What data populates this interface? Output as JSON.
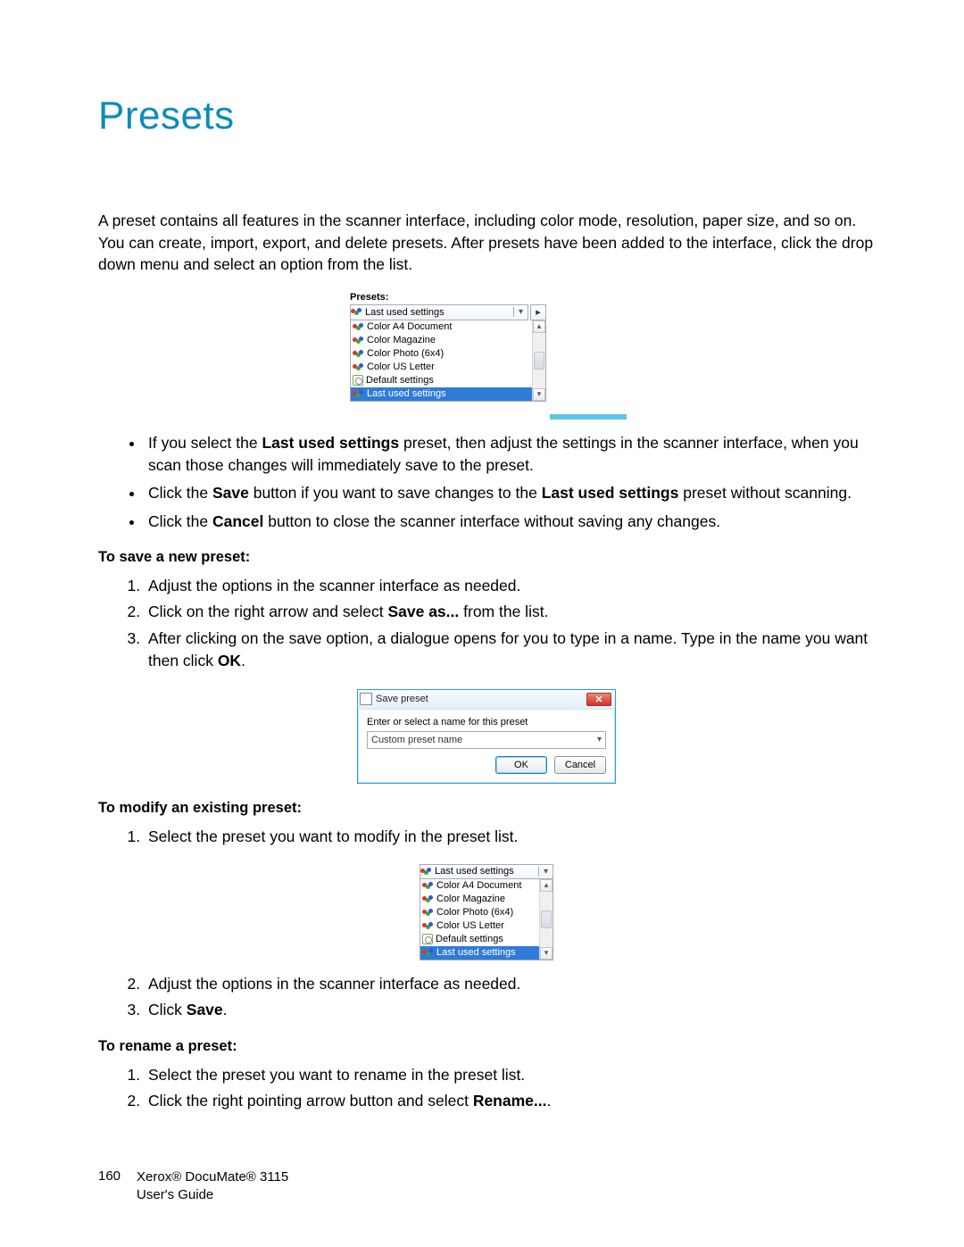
{
  "title": "Presets",
  "intro": "A preset contains all features in the scanner interface, including color mode, resolution, paper size, and so on. You can create, import, export, and delete presets. After presets have been added to the interface, click the drop down menu and select an option from the list.",
  "fig1": {
    "label": "Presets:",
    "selected": "Last used settings",
    "items": [
      "Color A4 Document",
      "Color Magazine",
      "Color Photo (6x4)",
      "Color US Letter",
      "Default settings",
      "Last used settings"
    ],
    "selected_index": 5
  },
  "bullets": [
    {
      "pre": "If you select the ",
      "b1": "Last used settings",
      "post": " preset, then adjust the settings in the scanner interface, when you scan those changes will immediately save to the preset."
    },
    {
      "pre": "Click the ",
      "b1": "Save",
      "mid": " button if you want to save changes to the ",
      "b2": "Last used settings",
      "post": " preset without scanning."
    },
    {
      "pre": "Click the ",
      "b1": "Cancel",
      "post": " button to close the scanner interface without saving any changes."
    }
  ],
  "save_head": "To save a new preset:",
  "save_steps": {
    "s1": "Adjust the options in the scanner interface as needed.",
    "s2_pre": "Click on the right arrow and select ",
    "s2_b": "Save as...",
    "s2_post": " from the list.",
    "s3_pre": "After clicking on the save option, a dialogue opens for you to type in a name. Type in the name you want then click ",
    "s3_b": "OK",
    "s3_post": "."
  },
  "dialog": {
    "title": "Save preset",
    "prompt": "Enter or select a name for this preset",
    "value": "Custom preset name",
    "ok": "OK",
    "cancel": "Cancel"
  },
  "modify_head": "To modify an existing preset:",
  "modify_steps": {
    "s1": "Select the preset you want to modify in the preset list.",
    "s2": "Adjust the options in the scanner interface as needed.",
    "s3_pre": "Click ",
    "s3_b": "Save",
    "s3_post": "."
  },
  "fig3": {
    "selected": "Last used settings",
    "items": [
      "Color A4 Document",
      "Color Magazine",
      "Color Photo (6x4)",
      "Color US Letter",
      "Default settings",
      "Last used settings"
    ],
    "selected_index": 5
  },
  "rename_head": "To rename a preset:",
  "rename_steps": {
    "s1": "Select the preset you want to rename in the preset list.",
    "s2_pre": "Click the right pointing arrow button and select ",
    "s2_b": "Rename...",
    "s2_post": "."
  },
  "footer": {
    "page": "160",
    "line1": "Xerox® DocuMate® 3115",
    "line2": "User's Guide"
  }
}
